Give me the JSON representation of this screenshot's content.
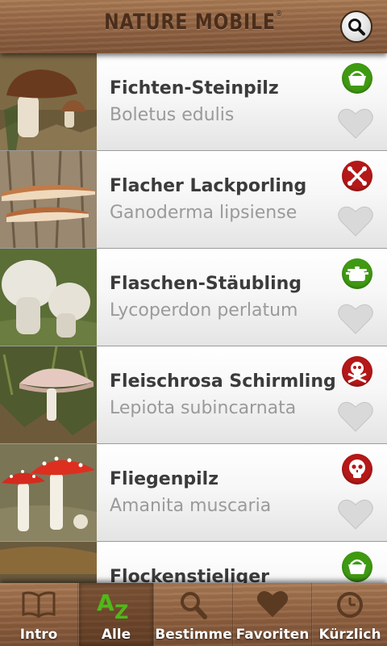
{
  "header": {
    "logo_text": "NATURE MOBILE",
    "logo_reg": "®",
    "search_icon": "search-icon"
  },
  "list": {
    "items": [
      {
        "name": "Fichten-Steinpilz",
        "latin": "Boletus edulis",
        "badge_icon": "basket-icon",
        "badge_color": "#3f9a12",
        "favorite": false
      },
      {
        "name": "Flacher Lackporling",
        "latin": "Ganoderma lipsiense",
        "badge_icon": "crossed-bones-icon",
        "badge_color": "#b51818",
        "favorite": false
      },
      {
        "name": "Flaschen-Stäubling",
        "latin": "Lycoperdon perlatum",
        "badge_icon": "cooking-pot-icon",
        "badge_color": "#3f9a12",
        "favorite": false
      },
      {
        "name": "Fleischrosa Schirmling",
        "latin": "Lepiota subincarnata",
        "badge_icon": "skull-crossbones-icon",
        "badge_color": "#b51818",
        "favorite": false
      },
      {
        "name": "Fliegenpilz",
        "latin": "Amanita muscaria",
        "badge_icon": "skull-icon",
        "badge_color": "#b51818",
        "favorite": false
      },
      {
        "name": "Flockenstieliger",
        "latin": "",
        "badge_icon": "basket-icon",
        "badge_color": "#3f9a12",
        "favorite": false
      }
    ]
  },
  "tabs": [
    {
      "label": "Intro",
      "icon": "book-icon",
      "active": false
    },
    {
      "label": "Alle",
      "icon": "a-z-icon",
      "active": true
    },
    {
      "label": "Bestimme",
      "icon": "magnifier-icon",
      "active": false
    },
    {
      "label": "Favoriten",
      "icon": "heart-icon",
      "active": false
    },
    {
      "label": "Kürzlich",
      "icon": "clock-icon",
      "active": false
    }
  ],
  "colors": {
    "wood": "#946544",
    "edible_green": "#3f9a12",
    "poison_red": "#b51818",
    "active_tab_icon": "#4fb81a"
  }
}
